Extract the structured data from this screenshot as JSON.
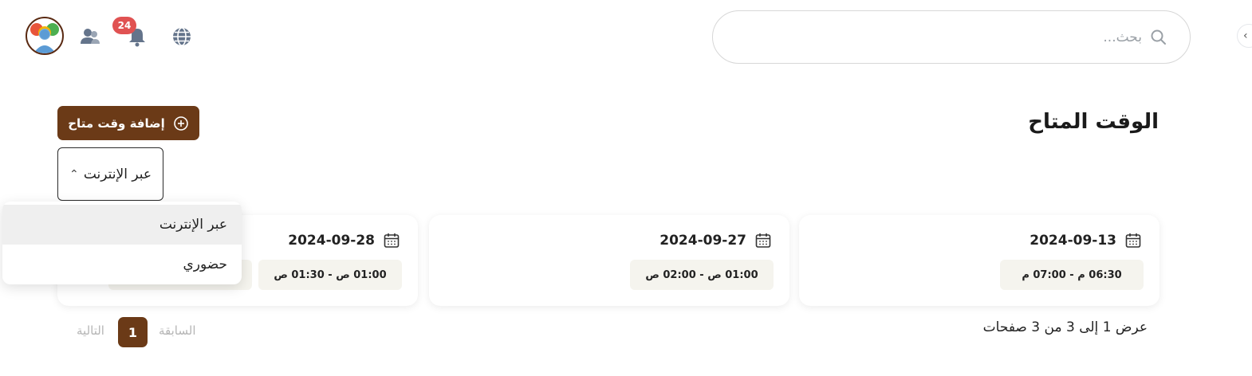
{
  "header": {
    "search_placeholder": "بحث...",
    "notification_count": "24",
    "icons": [
      "avatar",
      "users-icon",
      "bell-icon",
      "globe-icon",
      "search-icon",
      "sidebar-toggle-icon"
    ]
  },
  "page": {
    "title": "الوقت المتاح",
    "add_button_label": "إضافة وقت متاح"
  },
  "filter": {
    "selected": "عبر الإنترنت",
    "options": [
      "عبر الإنترنت",
      "حضوري"
    ]
  },
  "cards": [
    {
      "date": "2024-09-13",
      "slots": [
        "06:30 م - 07:00 م"
      ]
    },
    {
      "date": "2024-09-27",
      "slots": [
        "01:00 ص - 02:00 ص"
      ]
    },
    {
      "date": "2024-09-28",
      "slots": [
        "01:00 ص - 01:30 ص",
        ""
      ]
    }
  ],
  "pagination": {
    "info": "عرض 1 إلى 3 من 3 صفحات",
    "previous": "السابقة",
    "current": "1",
    "next": "التالية"
  },
  "colors": {
    "accent": "#6b3a17",
    "badge": "#e05252",
    "slot_bg": "#f5f4ee"
  }
}
